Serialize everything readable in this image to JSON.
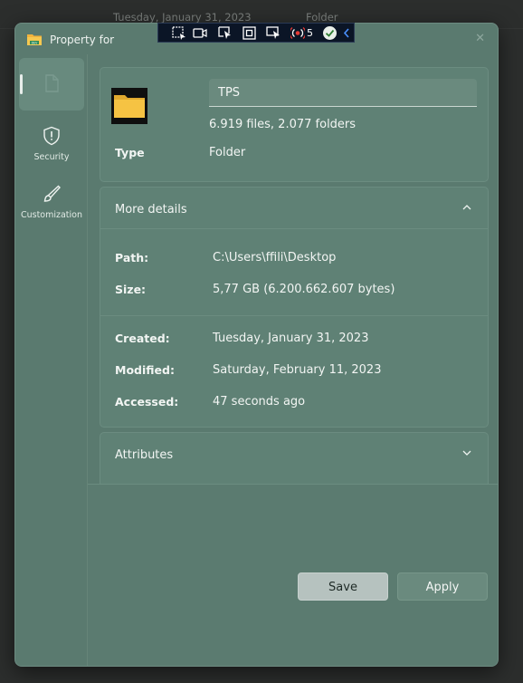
{
  "background": {
    "rows": [
      {
        "date": "Tuesday, January 31, 2023",
        "kind": "Folder"
      }
    ]
  },
  "window": {
    "title": "Property for",
    "close": "✕"
  },
  "recorder": {
    "count": "5"
  },
  "sidebar": {
    "items": [
      {
        "label": "",
        "icon": "file-icon",
        "selected": true
      },
      {
        "label": "Security",
        "icon": "shield-icon"
      },
      {
        "label": "Customization",
        "icon": "brush-icon"
      }
    ]
  },
  "summary": {
    "name": "TPS",
    "counts": "6.919 files, 2.077 folders",
    "type_label": "Type",
    "type_value": "Folder"
  },
  "more_details": {
    "title": "More details",
    "path_label": "Path:",
    "path_value": "C:\\Users\\ffili\\Desktop",
    "size_label": "Size:",
    "size_value": "5,77 GB (6.200.662.607 bytes)",
    "created_label": "Created:",
    "created_value": "Tuesday, January 31, 2023",
    "modified_label": "Modified:",
    "modified_value": "Saturday, February 11, 2023",
    "accessed_label": "Accessed:",
    "accessed_value": "47 seconds ago"
  },
  "attributes": {
    "title": "Attributes"
  },
  "footer": {
    "save_label": "Save",
    "apply_label": "Apply"
  },
  "colors": {
    "window_bg": "#5a7a6f",
    "card_bg": "#5f8175",
    "save_bg": "#b6c2bf",
    "folder_yellow": "#f6c343"
  }
}
